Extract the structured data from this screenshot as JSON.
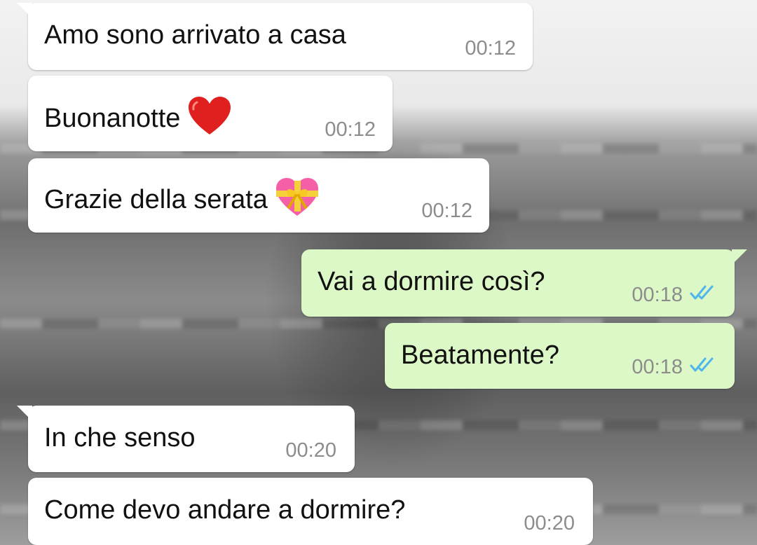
{
  "messages": [
    {
      "text": "Amo sono arrivato a casa",
      "time": "00:12",
      "direction": "incoming"
    },
    {
      "text": "Buonanotte",
      "emoji": "red-heart-icon",
      "time": "00:12",
      "direction": "incoming"
    },
    {
      "text": "Grazie della serata",
      "emoji": "heart-with-ribbon-icon",
      "time": "00:12",
      "direction": "incoming"
    },
    {
      "text": "Vai a dormire così?",
      "time": "00:18",
      "direction": "outgoing",
      "status": "read-double-check-icon"
    },
    {
      "text": "Beatamente?",
      "time": "00:18",
      "direction": "outgoing",
      "status": "read-double-check-icon"
    },
    {
      "text": "In che senso",
      "time": "00:20",
      "direction": "incoming"
    },
    {
      "text": "Come devo andare a dormire?",
      "time": "00:20",
      "direction": "incoming"
    }
  ],
  "colors": {
    "incoming_bubble": "#ffffff",
    "outgoing_bubble": "#dcf8c6",
    "timestamp": "#8c8c8c",
    "read_ticks": "#4fb6ec",
    "heart": "#e0201e",
    "ribbon_heart": "#f45fa8",
    "ribbon": "#f4d13b"
  }
}
